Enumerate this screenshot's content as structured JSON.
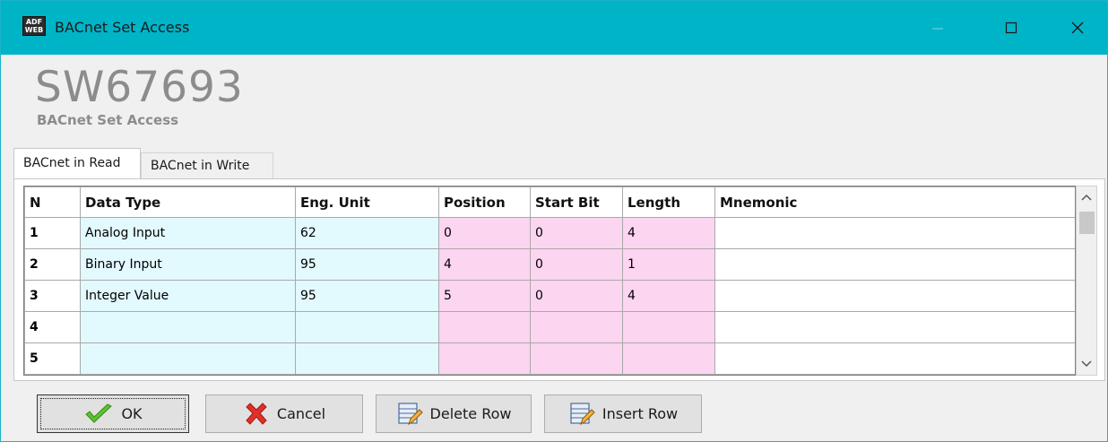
{
  "window": {
    "app_icon_text_line1": "ADF",
    "app_icon_text_line2": "WEB",
    "title": "BACnet Set Access",
    "accent_color": "#00b4c8"
  },
  "header": {
    "product_code": "SW67693",
    "subtitle": "BACnet Set Access"
  },
  "tabs": [
    {
      "label": "BACnet in Read",
      "active": true
    },
    {
      "label": "BACnet in Write",
      "active": false
    }
  ],
  "grid": {
    "columns": [
      "N",
      "Data Type",
      "Eng. Unit",
      "Position",
      "Start Bit",
      "Length",
      "Mnemonic"
    ],
    "rows": [
      {
        "n": "1",
        "data_type": "Analog Input",
        "eng_unit": "62",
        "position": "0",
        "start_bit": "0",
        "length": "4",
        "mnemonic": ""
      },
      {
        "n": "2",
        "data_type": "Binary Input",
        "eng_unit": "95",
        "position": "4",
        "start_bit": "0",
        "length": "1",
        "mnemonic": ""
      },
      {
        "n": "3",
        "data_type": "Integer Value",
        "eng_unit": "95",
        "position": "5",
        "start_bit": "0",
        "length": "4",
        "mnemonic": ""
      },
      {
        "n": "4",
        "data_type": "",
        "eng_unit": "",
        "position": "",
        "start_bit": "",
        "length": "",
        "mnemonic": ""
      },
      {
        "n": "5",
        "data_type": "",
        "eng_unit": "",
        "position": "",
        "start_bit": "",
        "length": "",
        "mnemonic": ""
      }
    ],
    "colors": {
      "cyan": "#e2f9fd",
      "pink": "#fcd5f1"
    }
  },
  "buttons": {
    "ok": "OK",
    "cancel": "Cancel",
    "delete_row": "Delete Row",
    "insert_row": "Insert Row"
  },
  "icons": {
    "ok": "checkmark-icon",
    "cancel": "red-x-icon",
    "delete_row": "table-pencil-icon",
    "insert_row": "table-pencil-icon"
  }
}
